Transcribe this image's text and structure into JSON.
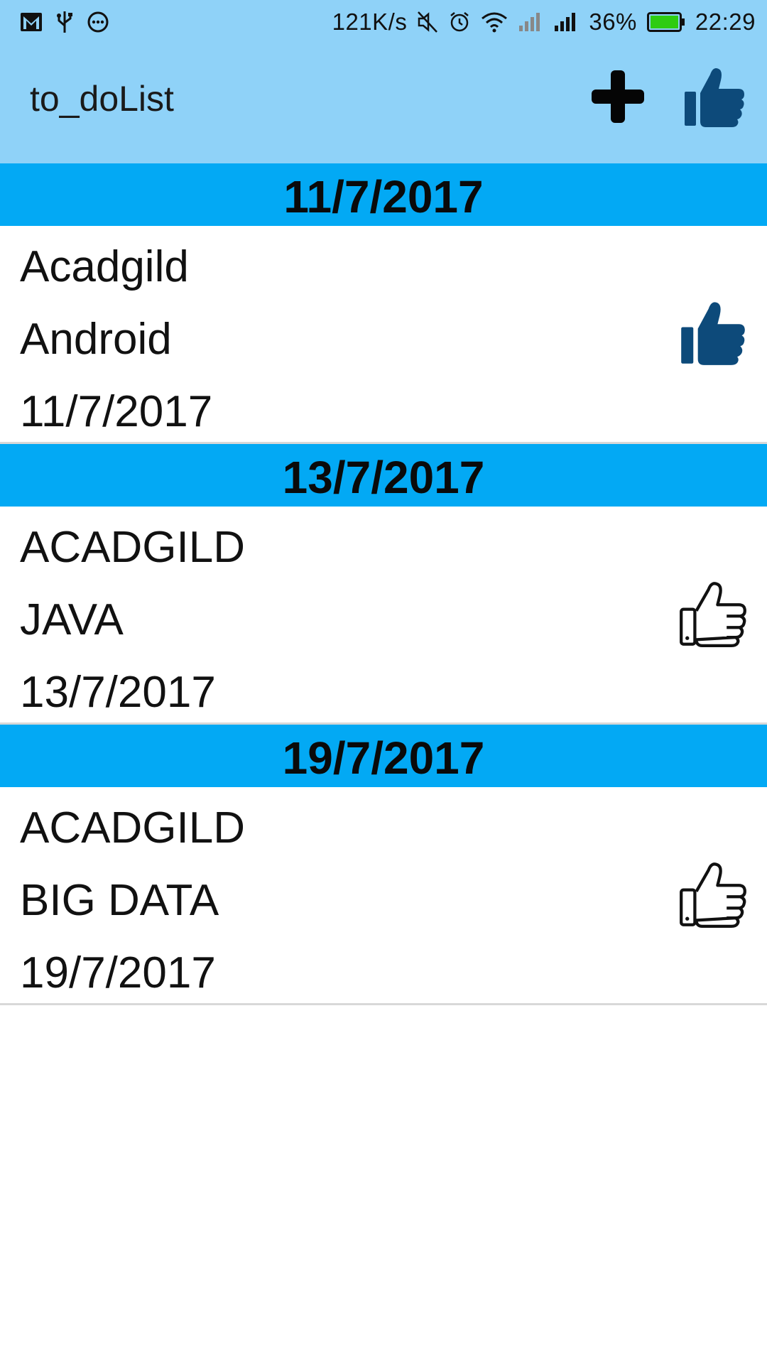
{
  "status_bar": {
    "left_icons": [
      "gmail-icon",
      "usb-icon",
      "more-icon"
    ],
    "net_speed": "121K/s",
    "right_icons": [
      "mute-icon",
      "alarm-icon",
      "wifi-icon",
      "signal-icon",
      "signal-icon"
    ],
    "battery_percent": "36%",
    "time": "22:29"
  },
  "app_bar": {
    "title": "to_doList",
    "actions": [
      {
        "name": "add-button",
        "icon": "plus-icon"
      },
      {
        "name": "completed-button",
        "icon": "thumbs-up-filled-icon"
      }
    ]
  },
  "groups": [
    {
      "date": "11/7/2017",
      "item": {
        "title": "Acadgild",
        "description": "Android",
        "date": "11/7/2017",
        "liked": true
      }
    },
    {
      "date": "13/7/2017",
      "item": {
        "title": "ACADGILD",
        "description": "JAVA",
        "date": "13/7/2017",
        "liked": false
      }
    },
    {
      "date": "19/7/2017",
      "item": {
        "title": "ACADGILD",
        "description": "BIG DATA",
        "date": "19/7/2017",
        "liked": false
      }
    }
  ],
  "colors": {
    "app_bar": "#8fd2f8",
    "group_header": "#03a9f4",
    "liked_icon": "#0d4a7a",
    "battery": "#2ecc11"
  }
}
